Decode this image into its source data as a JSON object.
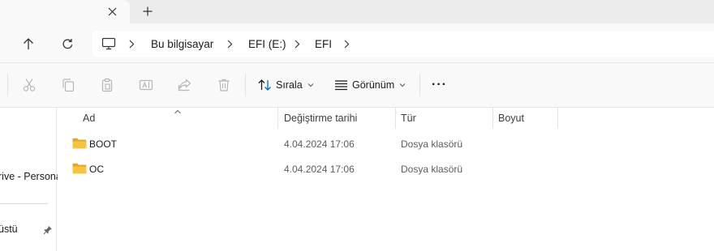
{
  "tabs": {
    "close_glyph": "✕",
    "new_tab_glyph": "+"
  },
  "address": {
    "breadcrumbs": [
      "Bu bilgisayar",
      "EFI (E:)",
      "EFI"
    ]
  },
  "toolbar": {
    "sort_label": "Sırala",
    "view_label": "Görünüm",
    "more_label": "···"
  },
  "nav_pane": {
    "items": [
      "rive - Persona",
      "üstü"
    ]
  },
  "columns": {
    "name": "Ad",
    "modified": "Değiştirme tarihi",
    "type": "Tür",
    "size": "Boyut"
  },
  "files": [
    {
      "name": "BOOT",
      "modified": "4.04.2024 17:06",
      "type": "Dosya klasörü",
      "size": ""
    },
    {
      "name": "OC",
      "modified": "4.04.2024 17:06",
      "type": "Dosya klasörü",
      "size": ""
    }
  ],
  "colors": {
    "folder": "#f5c542",
    "folder_dark": "#e0a92a",
    "accent": "#0067c0"
  }
}
